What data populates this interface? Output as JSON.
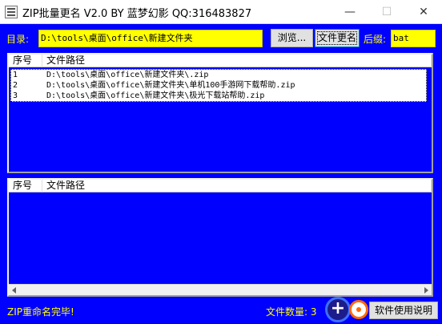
{
  "window": {
    "title": "ZIP批量更名 V2.0  BY 蓝梦幻影 QQ:316483827",
    "min_symbol": "—",
    "max_symbol": "☐",
    "close_symbol": "✕"
  },
  "toolbar": {
    "dir_label": "目录:",
    "dir_value": "D:\\tools\\桌面\\office\\新建文件夹",
    "browse_label": "浏览...",
    "rename_label": "文件更名",
    "suffix_label": "后缀:",
    "suffix_value": "bat"
  },
  "list_top": {
    "columns": [
      "序号",
      "文件路径"
    ],
    "rows": [
      {
        "index": "1",
        "path": "D:\\tools\\桌面\\office\\新建文件夹\\.zip"
      },
      {
        "index": "2",
        "path": "D:\\tools\\桌面\\office\\新建文件夹\\单机100手游网下载帮助.zip"
      },
      {
        "index": "3",
        "path": "D:\\tools\\桌面\\office\\新建文件夹\\极光下载站帮助.zip"
      }
    ]
  },
  "list_bottom": {
    "columns": [
      "序号",
      "文件路径"
    ],
    "rows": []
  },
  "status": {
    "message": "ZIP重命名完毕!",
    "count_label": "文件数量: 3"
  },
  "help": {
    "plus_symbol": "+",
    "label": "软件使用说明"
  },
  "colors": {
    "background": "#0000ff",
    "label_yellow": "#ffff00"
  }
}
